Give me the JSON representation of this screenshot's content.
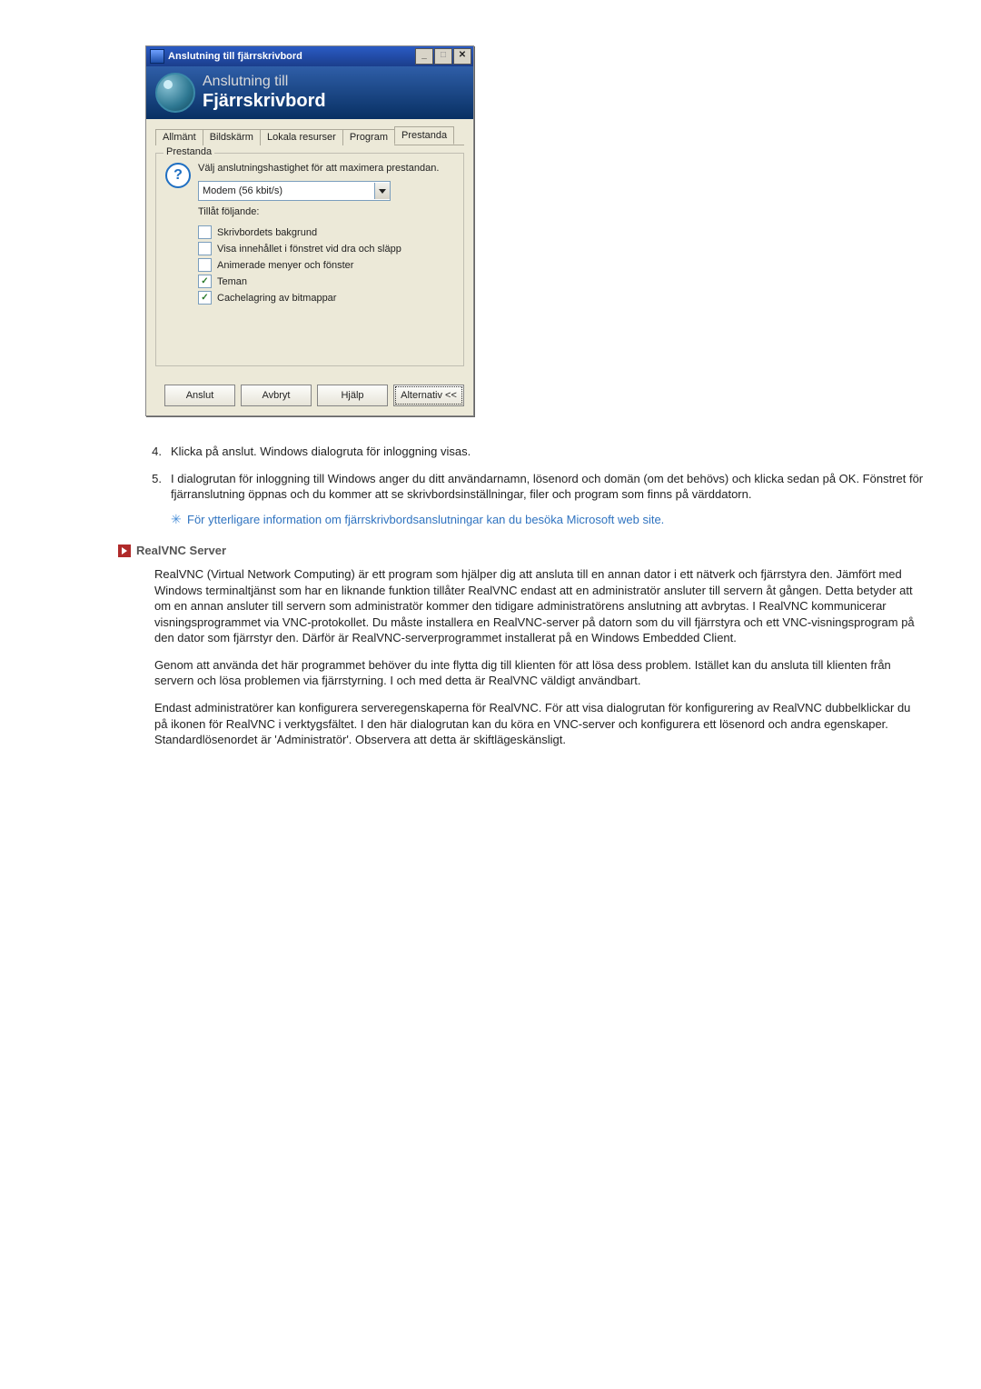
{
  "dialog": {
    "title": "Anslutning till fjärrskrivbord",
    "banner_line1": "Anslutning till",
    "banner_line2": "Fjärrskrivbord",
    "tabs": [
      "Allmänt",
      "Bildskärm",
      "Lokala resurser",
      "Program",
      "Prestanda"
    ],
    "active_tab_index": 4,
    "group_legend": "Prestanda",
    "perf_hint": "Välj anslutningshastighet för att maximera prestandan.",
    "dropdown_value": "Modem (56 kbit/s)",
    "allow_label": "Tillåt följande:",
    "checkboxes": [
      {
        "label": "Skrivbordets bakgrund",
        "checked": false
      },
      {
        "label": "Visa innehållet i fönstret vid dra och släpp",
        "checked": false
      },
      {
        "label": "Animerade menyer och fönster",
        "checked": false
      },
      {
        "label": "Teman",
        "checked": true
      },
      {
        "label": "Cachelagring av bitmappar",
        "checked": true
      }
    ],
    "buttons": {
      "connect": "Anslut",
      "cancel": "Avbryt",
      "help": "Hjälp",
      "options": "Alternativ <<"
    }
  },
  "list": {
    "item4_num": "4.",
    "item4_text": "Klicka på anslut. Windows dialogruta för inloggning visas.",
    "item5_num": "5.",
    "item5_text": "I dialogrutan för inloggning till Windows anger du ditt användarnamn, lösenord och domän (om det behövs) och klicka sedan på OK. Fönstret för fjärranslutning öppnas och du kommer att se skrivbordsinställningar, filer och program som finns på värddatorn.",
    "note_text": "För ytterligare information om fjärrskrivbordsanslutningar kan du besöka ",
    "note_link": "Microsoft web site."
  },
  "section": {
    "heading": "RealVNC Server",
    "para1": "RealVNC (Virtual Network Computing) är ett program som hjälper dig att ansluta till en annan dator i ett nätverk och fjärrstyra den. Jämfört med Windows terminaltjänst som har en liknande funktion tillåter RealVNC endast att en administratör ansluter till servern åt gången. Detta betyder att om en annan ansluter till servern som administratör kommer den tidigare administratörens anslutning att avbrytas. I RealVNC kommunicerar visningsprogrammet via VNC-protokollet. Du måste installera en RealVNC-server på datorn som du vill fjärrstyra och ett VNC-visningsprogram på den dator som fjärrstyr den. Därför är RealVNC-serverprogrammet installerat på en Windows Embedded Client.",
    "para2": "Genom att använda det här programmet behöver du inte flytta dig till klienten för att lösa dess problem. Istället kan du ansluta till klienten från servern och lösa problemen via fjärrstyrning. I och med detta är RealVNC väldigt användbart.",
    "para3": "Endast administratörer kan konfigurera serveregenskaperna för RealVNC. För att visa dialogrutan för konfigurering av RealVNC dubbelklickar du på ikonen för RealVNC i verktygsfältet. I den här dialogrutan kan du köra en VNC-server och konfigurera ett lösenord och andra egenskaper. Standardlösenordet är 'Administratör'. Observera att detta är skiftlägeskänsligt."
  }
}
